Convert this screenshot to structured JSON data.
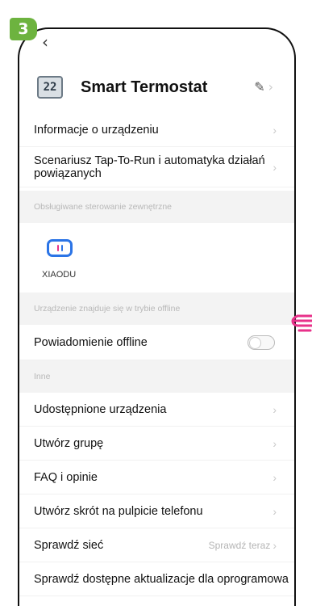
{
  "step_badge": "3",
  "nav": {
    "back_glyph": "‹"
  },
  "device": {
    "icon_text": "22",
    "name": "Smart Termostat",
    "edit_glyph": "✎",
    "chevron": "›"
  },
  "rows_top": [
    {
      "label": "Informacje o urządzeniu"
    },
    {
      "label": "Scenariusz Tap-To-Run i automatyka działań powiązanych"
    }
  ],
  "section_external": "Obsługiwane sterowanie zewnętrzne",
  "xiaodu": {
    "label": "XIAODU"
  },
  "section_offline": "Urządzenie znajduje się w trybie offline",
  "offline_row": {
    "label": "Powiadomienie offline",
    "enabled": false
  },
  "section_other": "Inne",
  "other_rows": [
    {
      "label": "Udostępnione urządzenia"
    },
    {
      "label": "Utwórz grupę"
    },
    {
      "label": "FAQ i opinie"
    },
    {
      "label": "Utwórz skrót na pulpicie telefonu"
    },
    {
      "label": "Sprawdź sieć",
      "sub": "Sprawdź teraz"
    },
    {
      "label": "Sprawdź dostępne aktualizacje dla oprogramowania"
    }
  ],
  "colors": {
    "badge": "#6db33f",
    "hand": "#e8318a",
    "xiaodu_blue": "#2b74e6"
  }
}
